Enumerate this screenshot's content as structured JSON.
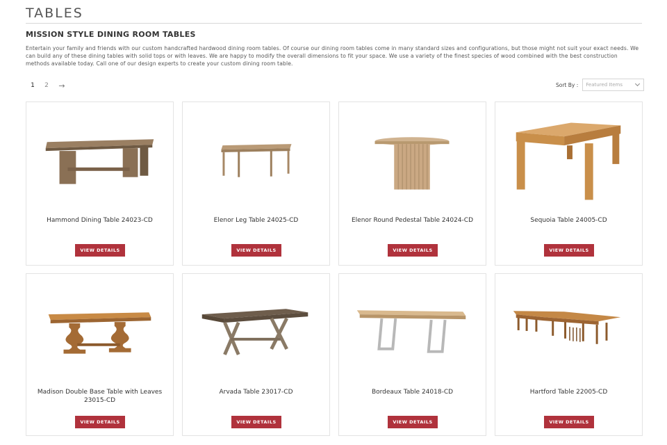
{
  "page": {
    "title": "TABLES",
    "heading": "MISSION STYLE DINING ROOM TABLES",
    "intro": "Entertain your family and friends with our custom handcrafted hardwood dining room tables. Of course our dining room tables come in many standard sizes and configurations, but those might not suit your exact needs. We can build any of these dining tables with solid tops or with leaves.  We are happy to modify the overall dimensions to fit your space.   We use a variety of the finest species of wood combined with the best construction methods available today.   Call one of our design experts to create your custom dining room table."
  },
  "pagination": {
    "pages": [
      "1",
      "2"
    ],
    "current": "1",
    "next_icon": "arrow-right-icon",
    "next_glyph": "→"
  },
  "sort": {
    "label": "Sort By :",
    "value": "Featured Items"
  },
  "colors": {
    "button": "#b0323c",
    "wood_light": "#c98f4a",
    "wood_dark": "#7a5535",
    "wood_gray": "#8a7a66"
  },
  "products": [
    {
      "name": "Hammond Dining Table 24023-CD",
      "button": "VIEW DETAILS",
      "image": "hammond-table-image"
    },
    {
      "name": "Elenor Leg Table 24025-CD",
      "button": "VIEW DETAILS",
      "image": "elenor-leg-table-image"
    },
    {
      "name": "Elenor Round Pedestal Table 24024-CD",
      "button": "VIEW DETAILS",
      "image": "elenor-round-pedestal-image"
    },
    {
      "name": "Sequoia Table 24005-CD",
      "button": "VIEW DETAILS",
      "image": "sequoia-table-image"
    },
    {
      "name": "Madison Double Base Table with Leaves 23015-CD",
      "button": "VIEW DETAILS",
      "image": "madison-table-image"
    },
    {
      "name": "Arvada Table 23017-CD",
      "button": "VIEW DETAILS",
      "image": "arvada-table-image"
    },
    {
      "name": "Bordeaux Table 24018-CD",
      "button": "VIEW DETAILS",
      "image": "bordeaux-table-image"
    },
    {
      "name": "Hartford Table 22005-CD",
      "button": "VIEW DETAILS",
      "image": "hartford-table-image"
    }
  ]
}
